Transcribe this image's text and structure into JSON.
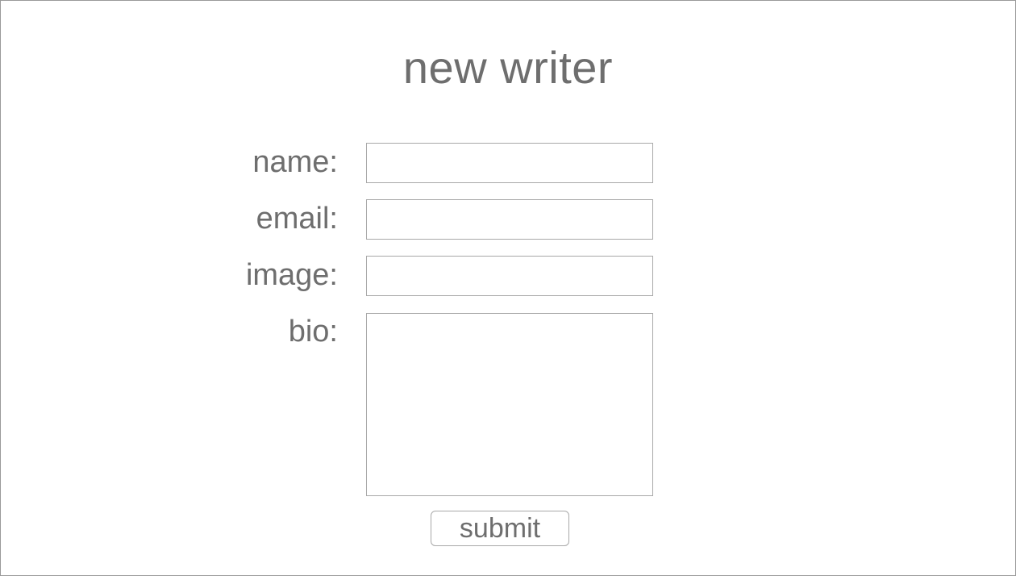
{
  "page": {
    "title": "new writer"
  },
  "form": {
    "fields": [
      {
        "label": "name:",
        "value": "",
        "placeholder": ""
      },
      {
        "label": "email:",
        "value": "",
        "placeholder": ""
      },
      {
        "label": "image:",
        "value": "",
        "placeholder": ""
      },
      {
        "label": "bio:",
        "value": "",
        "placeholder": ""
      }
    ],
    "submit_label": "submit"
  },
  "colors": {
    "text": "#6e6e6e",
    "border": "#a8a8a8",
    "background": "#ffffff"
  }
}
